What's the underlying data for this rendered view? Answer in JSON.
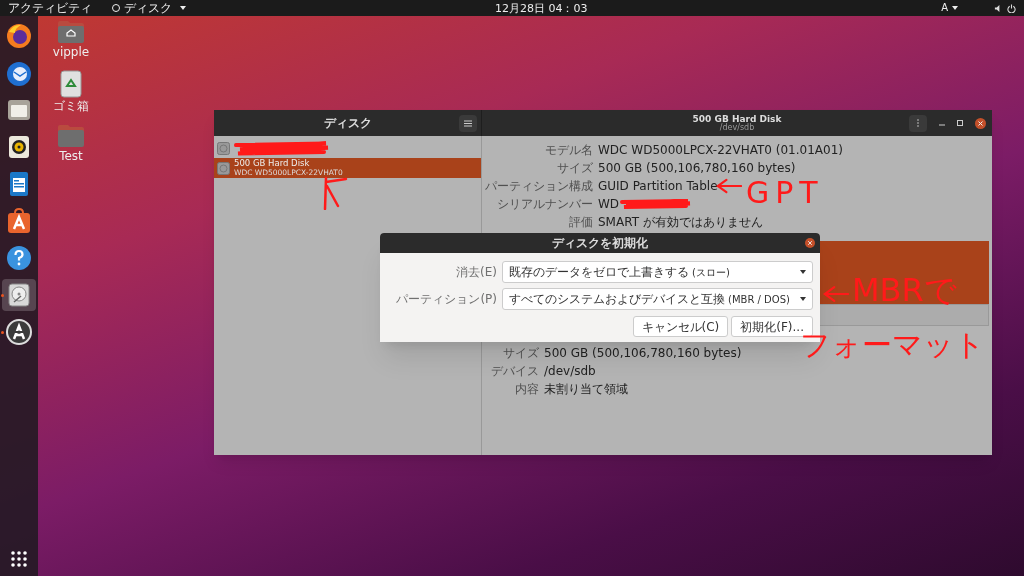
{
  "top_bar": {
    "activities": "アクティビティ",
    "app_menu": "ディスク",
    "clock": "12月28日 04：03",
    "input_method": "A"
  },
  "dock": [
    {
      "kind": "browser",
      "running": false,
      "selected": false
    },
    {
      "kind": "mail",
      "running": false,
      "selected": false
    },
    {
      "kind": "files",
      "running": false,
      "selected": false
    },
    {
      "kind": "music",
      "running": false,
      "selected": false
    },
    {
      "kind": "document",
      "running": false,
      "selected": false
    },
    {
      "kind": "store",
      "running": false,
      "selected": false
    },
    {
      "kind": "help",
      "running": false,
      "selected": false
    },
    {
      "kind": "disk",
      "running": true,
      "selected": true
    },
    {
      "kind": "update",
      "running": true,
      "selected": false
    }
  ],
  "desktop_icons": [
    {
      "kind": "home",
      "label": "vipple"
    },
    {
      "kind": "trash",
      "label": "ゴミ箱"
    },
    {
      "kind": "folder",
      "label": "Test"
    }
  ],
  "window": {
    "sidebar_title": "ディスク",
    "title": "500 GB Hard Disk",
    "subtitle": "/dev/sdb",
    "disks": [
      {
        "selected": false,
        "redacted": true
      },
      {
        "name": "500 GB Hard Disk",
        "model": "WDC WD5000LPCX-22VHAT0",
        "selected": true,
        "redacted": false
      }
    ],
    "details": [
      {
        "label": "モデル名",
        "value": "WDC WD5000LPCX-22VHAT0 (01.01A01)",
        "redacted": false
      },
      {
        "label": "サイズ",
        "value": "500 GB (500,106,780,160 bytes)",
        "redacted": false
      },
      {
        "label": "パーティション構成",
        "value": "GUID Partition Table",
        "redacted": false
      },
      {
        "label": "シリアルナンバー",
        "value": "WD",
        "redacted": true
      },
      {
        "label": "評価",
        "value": "SMART が有効ではありません",
        "redacted": false
      }
    ],
    "volume_details": [
      {
        "label": "サイズ",
        "value": "500 GB (500,106,780,160 bytes)"
      },
      {
        "label": "デバイス",
        "value": "/dev/sdb"
      },
      {
        "label": "内容",
        "value": "未割り当て領域"
      }
    ]
  },
  "dialog": {
    "title": "ディスクを初期化",
    "fields": [
      {
        "label": "消去(E)",
        "value": "既存のデータをゼロで上書きする",
        "note": "(スロー)"
      },
      {
        "label": "パーティション(P)",
        "value": "すべてのシステムおよびデバイスと互換",
        "note": "(MBR / DOS)"
      }
    ],
    "buttons": [
      "キャンセル(C)",
      "初期化(F)..."
    ]
  },
  "annotations": [
    "GPT",
    "MBRで",
    "フォーマット"
  ]
}
